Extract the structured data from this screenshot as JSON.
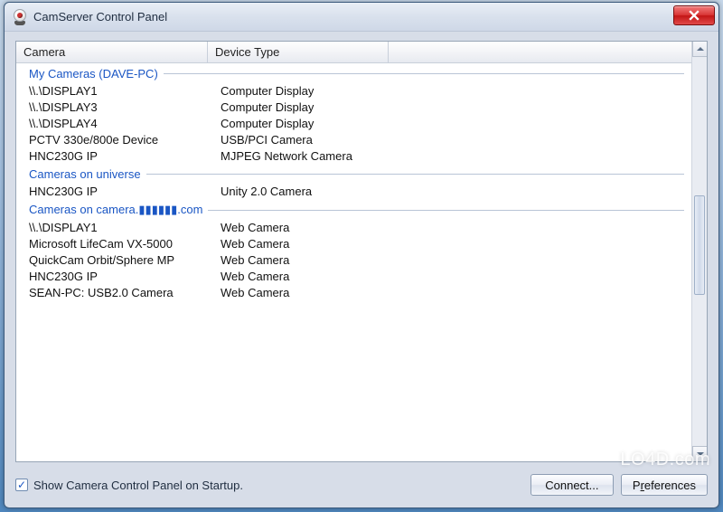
{
  "window": {
    "title": "CamServer Control Panel"
  },
  "columns": {
    "c1_label": "Camera",
    "c2_label": "Device Type",
    "c1_width": 212,
    "c2_width": 200
  },
  "groups": [
    {
      "label": "My Cameras (DAVE-PC)",
      "items": [
        {
          "camera": "\\\\.\\DISPLAY1",
          "type": "Computer Display"
        },
        {
          "camera": "\\\\.\\DISPLAY3",
          "type": "Computer Display"
        },
        {
          "camera": "\\\\.\\DISPLAY4",
          "type": "Computer Display"
        },
        {
          "camera": "PCTV 330e/800e Device",
          "type": "USB/PCI Camera"
        },
        {
          "camera": "HNC230G IP",
          "type": "MJPEG Network Camera"
        }
      ]
    },
    {
      "label": "Cameras on universe",
      "items": [
        {
          "camera": "HNC230G IP",
          "type": "Unity 2.0 Camera"
        }
      ]
    },
    {
      "label": "Cameras on camera.▮▮▮▮▮▮.com",
      "items": [
        {
          "camera": "\\\\.\\DISPLAY1",
          "type": "Web Camera"
        },
        {
          "camera": "Microsoft LifeCam VX-5000",
          "type": "Web Camera"
        },
        {
          "camera": "QuickCam Orbit/Sphere MP",
          "type": "Web Camera"
        },
        {
          "camera": "HNC230G IP",
          "type": "Web Camera"
        },
        {
          "camera": "SEAN-PC: USB2.0 Camera",
          "type": "Web Camera"
        }
      ]
    }
  ],
  "bottom": {
    "checkbox_label": "Show Camera Control Panel on Startup.",
    "checkbox_checked": true,
    "connect_label": "Connect...",
    "preferences_pre": "P",
    "preferences_u": "r",
    "preferences_post": "eferences"
  },
  "watermark": "LO4D.com"
}
